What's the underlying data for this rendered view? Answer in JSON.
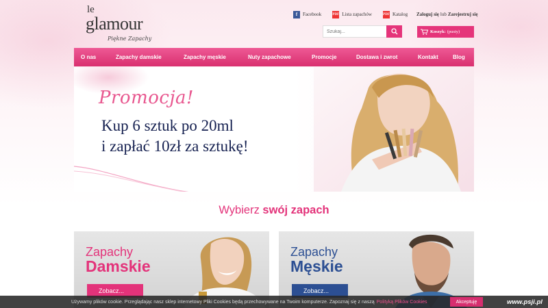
{
  "logo": {
    "prefix": "le",
    "name": "glamour",
    "tagline": "Piękne Zapachy"
  },
  "top_links": [
    {
      "label": "Facebook",
      "icon": "facebook-icon"
    },
    {
      "label": "Lista zapachów",
      "icon": "pdf-icon"
    },
    {
      "label": "Katalog",
      "icon": "pdf-icon"
    }
  ],
  "account": {
    "login": "Zaloguj się",
    "or": "lub",
    "register": "Zarejestruj się"
  },
  "search": {
    "placeholder": "Szukaj...",
    "icon": "search-icon"
  },
  "cart": {
    "label": "Koszyk:",
    "status": "(pusty)",
    "icon": "cart-icon"
  },
  "nav": [
    {
      "label": "O nas"
    },
    {
      "label": "Zapachy damskie"
    },
    {
      "label": "Zapachy męskie"
    },
    {
      "label": "Nuty zapachowe"
    },
    {
      "label": "Promocje"
    },
    {
      "label": "Dostawa i zwrot"
    },
    {
      "label": "Kontakt"
    },
    {
      "label": "Blog"
    }
  ],
  "banner": {
    "promo": "Promocja!",
    "line1": "Kup 6 sztuk po 20ml",
    "line2": "i zapłać 10zł za sztukę!"
  },
  "choose": {
    "prefix": "Wybierz",
    "bold": "swój zapach"
  },
  "cards": {
    "women": {
      "title1": "Zapachy",
      "title2": "Damskie",
      "button": "Zobacz..."
    },
    "men": {
      "title1": "Zapachy",
      "title2": "Męskie",
      "button": "Zobacz..."
    }
  },
  "cookie": {
    "text": "Używamy plików cookie. Przeglądając nasz sklep internetowy Pliki Cookies będą przechowywane na Twoim komputerze. Zapoznaj się z naszą",
    "link": "Polityką Plików Cookies",
    "accept": "Akceptuję"
  },
  "watermark": "www.psji.pl",
  "colors": {
    "accent": "#e3337a",
    "men_blue": "#2c4f93",
    "promo_navy": "#152050"
  }
}
